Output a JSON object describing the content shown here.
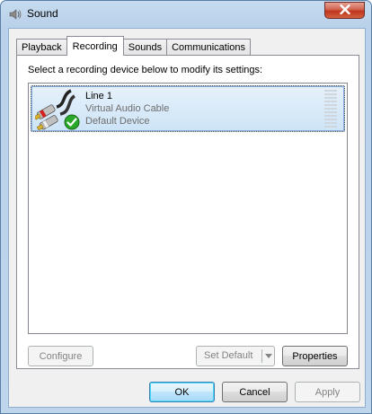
{
  "window": {
    "title": "Sound"
  },
  "tabs": [
    {
      "label": "Playback",
      "active": false
    },
    {
      "label": "Recording",
      "active": true
    },
    {
      "label": "Sounds",
      "active": false
    },
    {
      "label": "Communications",
      "active": false
    }
  ],
  "recording": {
    "instruction": "Select a recording device below to modify its settings:",
    "devices": [
      {
        "name": "Line 1",
        "description": "Virtual Audio Cable",
        "status": "Default Device",
        "icon": "rca-cable-icon",
        "default_badge": "green-check-icon",
        "selected": true
      }
    ],
    "buttons": {
      "configure": "Configure",
      "set_default": "Set Default",
      "properties": "Properties"
    }
  },
  "dialog_buttons": {
    "ok": "OK",
    "cancel": "Cancel",
    "apply": "Apply"
  },
  "colors": {
    "selection_border": "#84acdd",
    "check_green": "#2aa82a",
    "close_red": "#c0341d"
  }
}
